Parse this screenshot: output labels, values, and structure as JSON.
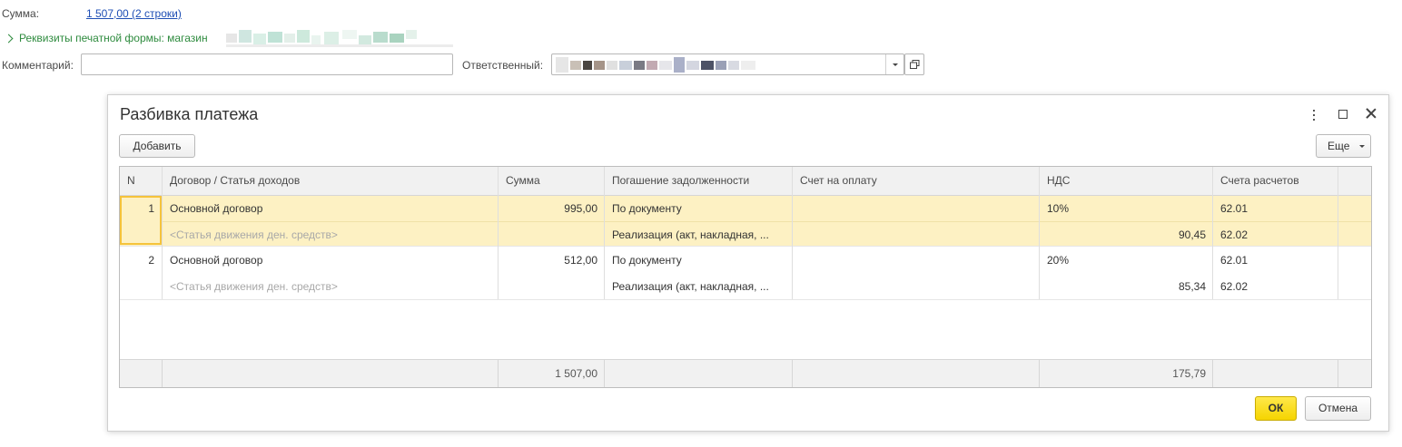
{
  "form": {
    "summa_label": "Сумма:",
    "summa_link": "1 507,00 (2 строки)",
    "rekvizity_label": "Реквизиты печатной формы: магазин",
    "comment_label": "Комментарий:",
    "comment_value": "",
    "otvetstvenny_label": "Ответственный:"
  },
  "dialog": {
    "title": "Разбивка платежа",
    "add_button": "Добавить",
    "more_button": "Еще",
    "ok_button": "ОК",
    "cancel_button": "Отмена"
  },
  "table": {
    "headers": {
      "n": "N",
      "dogovor": "Договор / Статья доходов",
      "summa": "Сумма",
      "pogashenie": "Погашение задолженности",
      "schet_oplatu": "Счет на оплату",
      "nds": "НДС",
      "scheta": "Счета расчетов"
    },
    "rows": [
      {
        "n": "1",
        "dogovor": "Основной договор",
        "statya": "<Статья движения ден. средств>",
        "summa": "995,00",
        "pogashenie": "По документу",
        "pogashenie2": "Реализация (акт, накладная, ...",
        "schet_oplatu": "",
        "nds": "10%",
        "nds_summa": "90,45",
        "schet1": "62.01",
        "schet2": "62.02"
      },
      {
        "n": "2",
        "dogovor": "Основной договор",
        "statya": "<Статья движения ден. средств>",
        "summa": "512,00",
        "pogashenie": "По документу",
        "pogashenie2": "Реализация (акт, накладная, ...",
        "schet_oplatu": "",
        "nds": "20%",
        "nds_summa": "85,34",
        "schet1": "62.01",
        "schet2": "62.02"
      }
    ],
    "totals": {
      "summa": "1 507,00",
      "nds": "175,79"
    }
  }
}
